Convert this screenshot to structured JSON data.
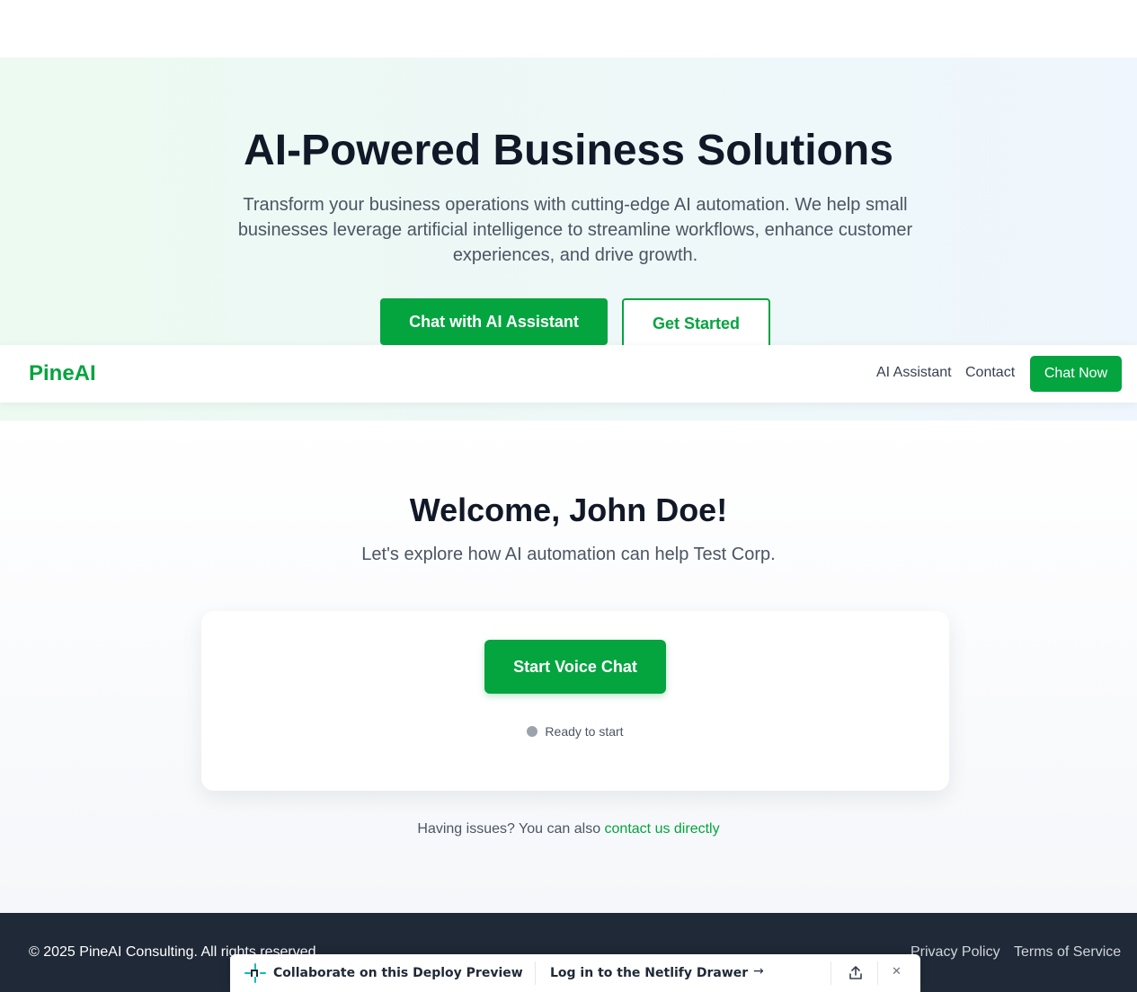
{
  "hero": {
    "title": "AI-Powered Business Solutions",
    "subtitle": "Transform your business operations with cutting-edge AI automation. We help small businesses leverage artificial intelligence to streamline workflows, enhance customer experiences, and drive growth.",
    "primary_button": "Chat with AI Assistant",
    "secondary_button": "Get Started"
  },
  "navbar": {
    "logo": "PineAI",
    "links": [
      "AI Assistant",
      "Contact"
    ],
    "cta": "Chat Now"
  },
  "main": {
    "welcome": "Welcome, John Doe!",
    "subtitle": "Let's explore how AI automation can help Test Corp.",
    "voice_button": "Start Voice Chat",
    "status": "Ready to start",
    "issues_text": "Having issues? You can also ",
    "issues_link": "contact us directly"
  },
  "footer": {
    "copyright": "© 2025 PineAI Consulting. All rights reserved.",
    "links": [
      "Privacy Policy",
      "Terms of Service"
    ]
  },
  "netlify_drawer": {
    "collab_text": "Collaborate on this Deploy Preview",
    "login_text": "Log in to the Netlify Drawer",
    "arrow": "→",
    "close": "✕"
  },
  "colors": {
    "brand_green": "#04a43f",
    "footer_bg": "#1f2937",
    "status_idle": "#9ca3af"
  },
  "icons": [
    "netlify-logo-icon",
    "arrow-right-icon",
    "share-icon",
    "close-icon",
    "status-dot-icon"
  ]
}
